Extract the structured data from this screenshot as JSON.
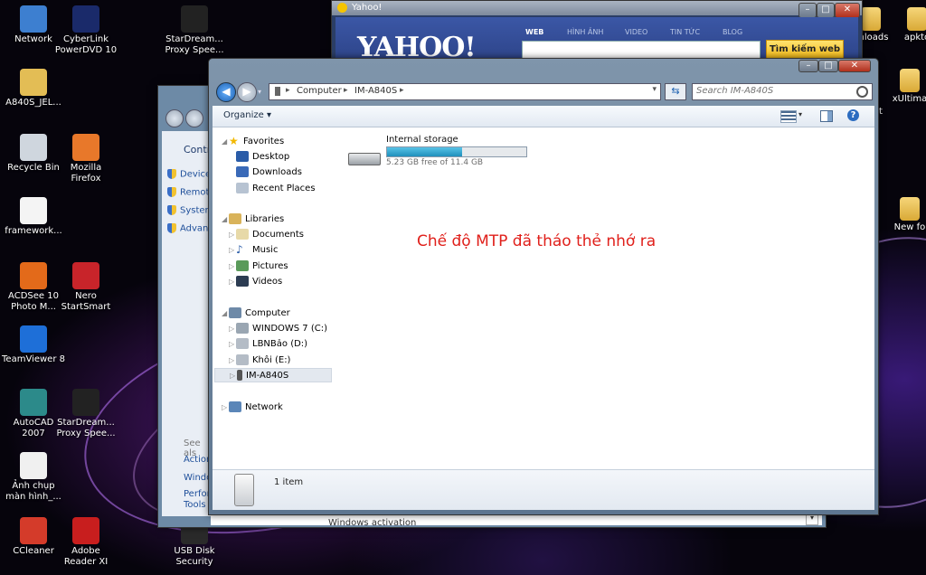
{
  "desktop": {
    "icons_left": [
      {
        "label": "Network",
        "icon": "network-icon"
      },
      {
        "label": "CyberLink PowerDVD 10",
        "icon": "powerdvd-icon"
      },
      {
        "label": "StarDream... Proxy Spee...",
        "icon": "stardream-icon"
      },
      {
        "label": "A840S_JEL...",
        "icon": "folder-icon"
      },
      {
        "label": "Recycle Bin",
        "icon": "recycle-bin-icon"
      },
      {
        "label": "Mozilla Firefox",
        "icon": "firefox-icon"
      },
      {
        "label": "framework...",
        "icon": "document-icon"
      },
      {
        "label": "ACDSee 10 Photo M...",
        "icon": "acdsee-icon"
      },
      {
        "label": "Nero StartSmart",
        "icon": "nero-icon"
      },
      {
        "label": "TeamViewer 8",
        "icon": "teamviewer-icon"
      },
      {
        "label": "AutoCAD 2007",
        "icon": "autocad-icon"
      },
      {
        "label": "StarDream... Proxy Spee...",
        "icon": "stardream-icon"
      },
      {
        "label": "Ảnh chụp màn hình_...",
        "icon": "image-icon"
      },
      {
        "label": "CCleaner",
        "icon": "ccleaner-icon"
      },
      {
        "label": "Adobe Reader XI",
        "icon": "adobe-reader-icon"
      },
      {
        "label": "USB Disk Security",
        "icon": "usb-security-icon"
      }
    ],
    "icons_right": [
      {
        "label": "nloads"
      },
      {
        "label": "apkto"
      },
      {
        "label": "xUltima"
      },
      {
        "label": "New fo"
      }
    ],
    "right_fragment": "t"
  },
  "yahoo": {
    "title": "Yahoo!",
    "logo": "YAHOO!",
    "tabs": [
      "WEB",
      "HÌNH ẢNH",
      "VIDEO",
      "TIN TỨC",
      "BLOG"
    ],
    "search_button": "Tìm kiếm web"
  },
  "control_panel": {
    "header": "Contro",
    "links": [
      "Device",
      "Remot",
      "Syster",
      "Advan"
    ],
    "see_also": "See als",
    "bottom_links": [
      "Action",
      "Windo",
      "Perfor Tools"
    ],
    "status_fragment": "Windows activation"
  },
  "explorer": {
    "address": {
      "parts": [
        "Computer",
        "IM-A840S"
      ]
    },
    "search_placeholder": "Search IM-A840S",
    "toolbar": {
      "organize": "Organize"
    },
    "nav": {
      "favorites": "Favorites",
      "favorites_items": [
        "Desktop",
        "Downloads",
        "Recent Places"
      ],
      "libraries": "Libraries",
      "libraries_items": [
        "Documents",
        "Music",
        "Pictures",
        "Videos"
      ],
      "computer": "Computer",
      "computer_items": [
        "WINDOWS 7 (C:)",
        "LBNBảo (D:)",
        "Khôi (E:)",
        "IM-A840S"
      ],
      "network": "Network"
    },
    "storage": {
      "name": "Internal storage",
      "free_text": "5.23 GB free of 11.4 GB",
      "used_fraction": 0.54
    },
    "annotation": "Chế độ MTP đã tháo thẻ nhớ ra",
    "status": "1 item"
  },
  "colors": {
    "annotation": "#e0201b",
    "storage_bar": "#2aa0c8"
  }
}
